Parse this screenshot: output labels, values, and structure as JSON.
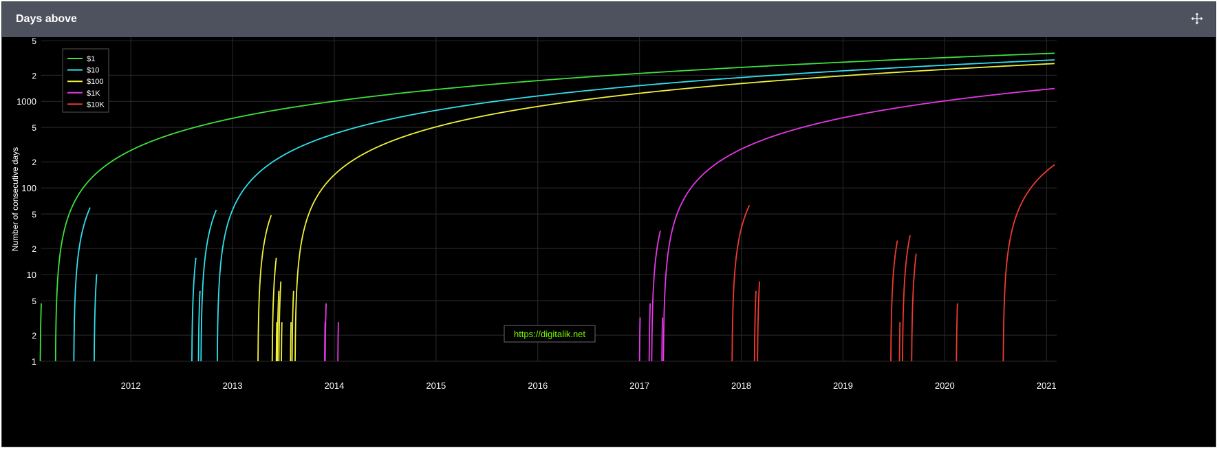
{
  "header": {
    "title": "Days above",
    "move_icon": "move-arrows-icon"
  },
  "watermark": "https://digitalik.net",
  "colors": {
    "background": "#000000",
    "grid": "#2b2b2b",
    "axis_text": "#ffffff",
    "watermark_text": "#7CFC00"
  },
  "chart_data": {
    "type": "line",
    "title": "Days above",
    "xlabel": "",
    "ylabel": "Number of consecutive days",
    "yscale": "log",
    "xlim": [
      2011.12,
      2021.1
    ],
    "ylim": [
      1,
      5500
    ],
    "x_ticks": [
      2012,
      2013,
      2014,
      2015,
      2016,
      2017,
      2018,
      2019,
      2020,
      2021
    ],
    "x_tick_labels": [
      "2012",
      "2013",
      "2014",
      "2015",
      "2016",
      "2017",
      "2018",
      "2019",
      "2020",
      "2021"
    ],
    "y_ticks": [
      1,
      2,
      5,
      10,
      20,
      50,
      100,
      200,
      500,
      1000,
      2000,
      5000
    ],
    "y_tick_labels": [
      "1",
      "2",
      "5",
      "10",
      "2",
      "5",
      "100",
      "2",
      "5",
      "1000",
      "2",
      "5"
    ],
    "grid": true,
    "legend_position": "top-left",
    "series": [
      {
        "name": "$1",
        "color": "#3de23d",
        "segments": [
          {
            "start": 2011.11,
            "end": 2011.12,
            "grow": true
          },
          {
            "start": 2011.26,
            "end": 2021.08,
            "grow": true
          }
        ]
      },
      {
        "name": "$10",
        "color": "#2fe1ee",
        "segments": [
          {
            "start": 2011.44,
            "end": 2011.6,
            "grow": true
          },
          {
            "start": 2011.64,
            "end": 2011.665,
            "grow": true
          },
          {
            "start": 2012.6,
            "end": 2012.64,
            "grow": true
          },
          {
            "start": 2012.665,
            "end": 2012.68,
            "grow": true
          },
          {
            "start": 2012.69,
            "end": 2012.84,
            "grow": true
          },
          {
            "start": 2012.85,
            "end": 2021.08,
            "grow": true
          }
        ]
      },
      {
        "name": "$100",
        "color": "#f2f23a",
        "segments": [
          {
            "start": 2013.25,
            "end": 2013.38,
            "grow": true
          },
          {
            "start": 2013.39,
            "end": 2013.43,
            "grow": true
          },
          {
            "start": 2013.43,
            "end": 2013.435,
            "grow": true
          },
          {
            "start": 2013.44,
            "end": 2013.455,
            "grow": true
          },
          {
            "start": 2013.455,
            "end": 2013.475,
            "grow": true
          },
          {
            "start": 2013.48,
            "end": 2013.485,
            "grow": true
          },
          {
            "start": 2013.57,
            "end": 2013.575,
            "grow": true
          },
          {
            "start": 2013.585,
            "end": 2013.6,
            "grow": true
          },
          {
            "start": 2013.615,
            "end": 2021.08,
            "grow": true
          }
        ]
      },
      {
        "name": "$1K",
        "color": "#e637e6",
        "segments": [
          {
            "start": 2013.905,
            "end": 2013.91,
            "grow": true
          },
          {
            "start": 2013.91,
            "end": 2013.92,
            "grow": true
          },
          {
            "start": 2014.035,
            "end": 2014.04,
            "grow": true
          },
          {
            "start": 2017.0,
            "end": 2017.006,
            "grow": true
          },
          {
            "start": 2017.095,
            "end": 2017.105,
            "grow": true
          },
          {
            "start": 2017.12,
            "end": 2017.205,
            "grow": true
          },
          {
            "start": 2017.22,
            "end": 2017.226,
            "grow": true
          },
          {
            "start": 2017.235,
            "end": 2021.08,
            "grow": true
          }
        ]
      },
      {
        "name": "$10K",
        "color": "#f03a2e",
        "segments": [
          {
            "start": 2017.91,
            "end": 2018.08,
            "grow": true
          },
          {
            "start": 2018.13,
            "end": 2018.145,
            "grow": true
          },
          {
            "start": 2018.16,
            "end": 2018.18,
            "grow": true
          },
          {
            "start": 2019.47,
            "end": 2019.535,
            "grow": true
          },
          {
            "start": 2019.555,
            "end": 2019.56,
            "grow": true
          },
          {
            "start": 2019.585,
            "end": 2019.66,
            "grow": true
          },
          {
            "start": 2019.675,
            "end": 2019.72,
            "grow": true
          },
          {
            "start": 2020.115,
            "end": 2020.125,
            "grow": true
          },
          {
            "start": 2020.575,
            "end": 2021.08,
            "grow": true
          }
        ]
      }
    ]
  }
}
